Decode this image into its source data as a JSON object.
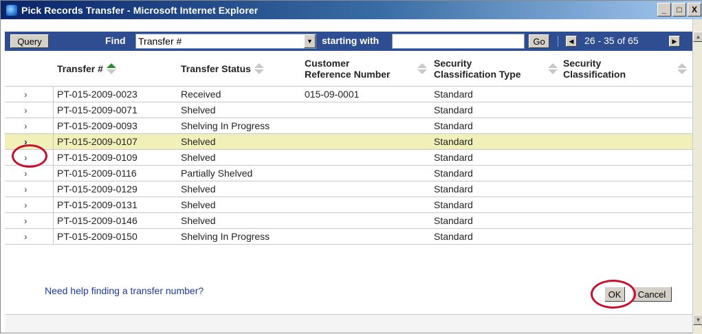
{
  "window": {
    "title": "Pick Records Transfer - Microsoft Internet Explorer",
    "minimize": "_",
    "maximize": "□",
    "close": "X"
  },
  "toolbar": {
    "query_label": "Query",
    "find_label": "Find",
    "find_selected": "Transfer #",
    "starting_label": "starting with",
    "start_value": "",
    "go_label": "Go",
    "pagination": "26 - 35 of 65"
  },
  "table": {
    "columns": [
      "Transfer #",
      "Transfer Status",
      "Customer\nReference Number",
      "Security\nClassification Type",
      "Security\nClassification"
    ],
    "rows": [
      {
        "transfer": "PT-015-2009-0023",
        "status": "Received",
        "customer_ref": "015-09-0001",
        "sec_type": "Standard",
        "sec_class": ""
      },
      {
        "transfer": "PT-015-2009-0071",
        "status": "Shelved",
        "customer_ref": "",
        "sec_type": "Standard",
        "sec_class": ""
      },
      {
        "transfer": "PT-015-2009-0093",
        "status": "Shelving In Progress",
        "customer_ref": "",
        "sec_type": "Standard",
        "sec_class": ""
      },
      {
        "transfer": "PT-015-2009-0107",
        "status": "Shelved",
        "customer_ref": "",
        "sec_type": "Standard",
        "sec_class": "",
        "selected": true
      },
      {
        "transfer": "PT-015-2009-0109",
        "status": "Shelved",
        "customer_ref": "",
        "sec_type": "Standard",
        "sec_class": ""
      },
      {
        "transfer": "PT-015-2009-0116",
        "status": "Partially Shelved",
        "customer_ref": "",
        "sec_type": "Standard",
        "sec_class": ""
      },
      {
        "transfer": "PT-015-2009-0129",
        "status": "Shelved",
        "customer_ref": "",
        "sec_type": "Standard",
        "sec_class": ""
      },
      {
        "transfer": "PT-015-2009-0131",
        "status": "Shelved",
        "customer_ref": "",
        "sec_type": "Standard",
        "sec_class": ""
      },
      {
        "transfer": "PT-015-2009-0146",
        "status": "Shelved",
        "customer_ref": "",
        "sec_type": "Standard",
        "sec_class": ""
      },
      {
        "transfer": "PT-015-2009-0150",
        "status": "Shelving In Progress",
        "customer_ref": "",
        "sec_type": "Standard",
        "sec_class": ""
      }
    ],
    "row_arrow": "›"
  },
  "footer": {
    "help_link": "Need help finding a transfer number?",
    "ok_label": "OK",
    "cancel_label": "Cancel"
  },
  "colors": {
    "toolbar_bg": "#2f4d91",
    "selected_row": "#f0f0b8",
    "highlight_circle": "#c8102e",
    "link": "#1a3aa0"
  }
}
